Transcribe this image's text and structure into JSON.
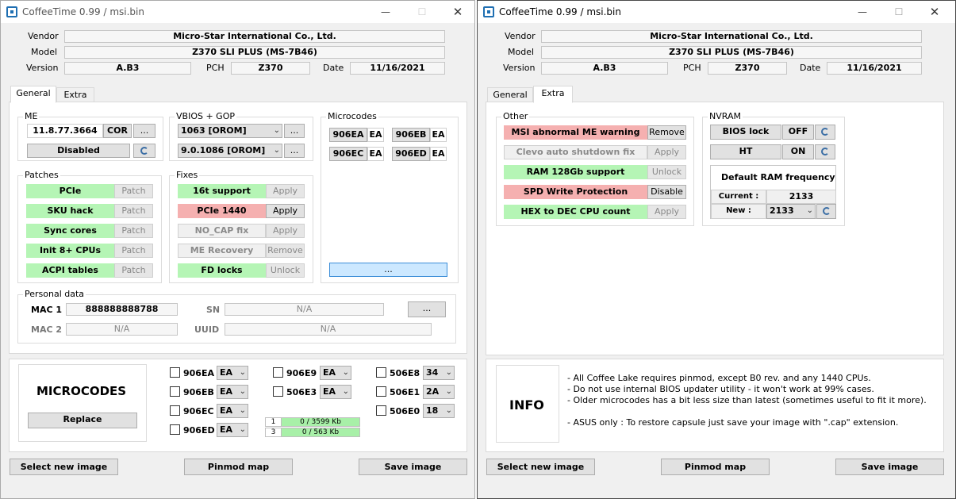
{
  "window_title": "CoffeeTime 0.99  /  msi.bin",
  "header": {
    "vendor_label": "Vendor",
    "vendor": "Micro-Star International Co., Ltd.",
    "model_label": "Model",
    "model": "Z370 SLI PLUS (MS-7B46)",
    "version_label": "Version",
    "version": "A.B3",
    "pch_label": "PCH",
    "pch": "Z370",
    "date_label": "Date",
    "date": "11/16/2021"
  },
  "tabs": [
    "General",
    "Extra"
  ],
  "general": {
    "me": {
      "title": "ME",
      "version": "11.8.77.3664",
      "cor": "COR",
      "more": "...",
      "state": "Disabled"
    },
    "vbios": {
      "title": "VBIOS + GOP",
      "sel1": "1063 [OROM]",
      "sel2": "9.0.1086 [OROM]",
      "more": "..."
    },
    "microcodes": {
      "title": "Microcodes",
      "items": [
        {
          "id": "906EA",
          "tag": "EA"
        },
        {
          "id": "906EB",
          "tag": "EA"
        },
        {
          "id": "906EC",
          "tag": "EA"
        },
        {
          "id": "906ED",
          "tag": "EA"
        }
      ],
      "more": "..."
    },
    "patches": {
      "title": "Patches",
      "items": [
        {
          "name": "PCIe",
          "action": "Patch"
        },
        {
          "name": "SKU hack",
          "action": "Patch"
        },
        {
          "name": "Sync cores",
          "action": "Patch"
        },
        {
          "name": "Init 8+ CPUs",
          "action": "Patch"
        },
        {
          "name": "ACPI tables",
          "action": "Patch"
        }
      ]
    },
    "fixes": {
      "title": "Fixes",
      "items": [
        {
          "name": "16t support",
          "action": "Apply"
        },
        {
          "name": "PCIe 1440",
          "action": "Apply"
        },
        {
          "name": "NO_CAP fix",
          "action": "Apply"
        },
        {
          "name": "ME Recovery",
          "action": "Remove"
        },
        {
          "name": "FD locks",
          "action": "Unlock"
        }
      ]
    },
    "personal": {
      "title": "Personal data",
      "mac1_label": "MAC 1",
      "mac1": "888888888788",
      "mac2_label": "MAC 2",
      "mac2": "N/A",
      "sn_label": "SN",
      "sn": "N/A",
      "uuid_label": "UUID",
      "uuid": "N/A",
      "more": "..."
    }
  },
  "bottom_left": {
    "title": "MICROCODES",
    "replace": "Replace",
    "codes": [
      {
        "id": "906EA",
        "val": "EA"
      },
      {
        "id": "906EB",
        "val": "EA"
      },
      {
        "id": "906EC",
        "val": "EA"
      },
      {
        "id": "906ED",
        "val": "EA"
      },
      {
        "id": "906E9",
        "val": "EA"
      },
      {
        "id": "506E3",
        "val": "EA"
      },
      {
        "id": "506E8",
        "val": "34"
      },
      {
        "id": "506E1",
        "val": "2A"
      },
      {
        "id": "506E0",
        "val": "18"
      }
    ],
    "bars": [
      {
        "n": "1",
        "v": "0 / 3599 Kb"
      },
      {
        "n": "3",
        "v": "0 / 563 Kb"
      }
    ]
  },
  "extra": {
    "other_title": "Other",
    "other": [
      {
        "name": "MSI abnormal ME warning",
        "action": "Remove"
      },
      {
        "name": "Clevo auto shutdown fix",
        "action": "Apply"
      },
      {
        "name": "RAM 128Gb support",
        "action": "Unlock"
      },
      {
        "name": "SPD Write Protection",
        "action": "Disable"
      },
      {
        "name": "HEX to DEC CPU count",
        "action": "Apply"
      }
    ],
    "nvram_title": "NVRAM",
    "bios_lock": "BIOS lock",
    "bios_lock_val": "OFF",
    "ht": "HT",
    "ht_val": "ON",
    "ram_freq_title": "Default RAM frequency",
    "current_label": "Current :",
    "current": "2133",
    "new_label": "New :",
    "new_val": "2133"
  },
  "info": {
    "title": "INFO",
    "lines": [
      "- All Coffee Lake requires pinmod, except B0 rev. and any 1440 CPUs.",
      "- Do not use internal BIOS updater utility - it won't work at 99% cases.",
      "- Older microcodes has a bit less size than latest (sometimes useful to fit it more).",
      "",
      "- ASUS only : To restore capsule just save your image with \".cap\" extension."
    ]
  },
  "buttons": {
    "select": "Select new image",
    "pinmod": "Pinmod map",
    "save": "Save image"
  },
  "colors": {
    "green": "#b5f5b5",
    "red": "#f5b0b0",
    "blue": "#cce8ff"
  }
}
